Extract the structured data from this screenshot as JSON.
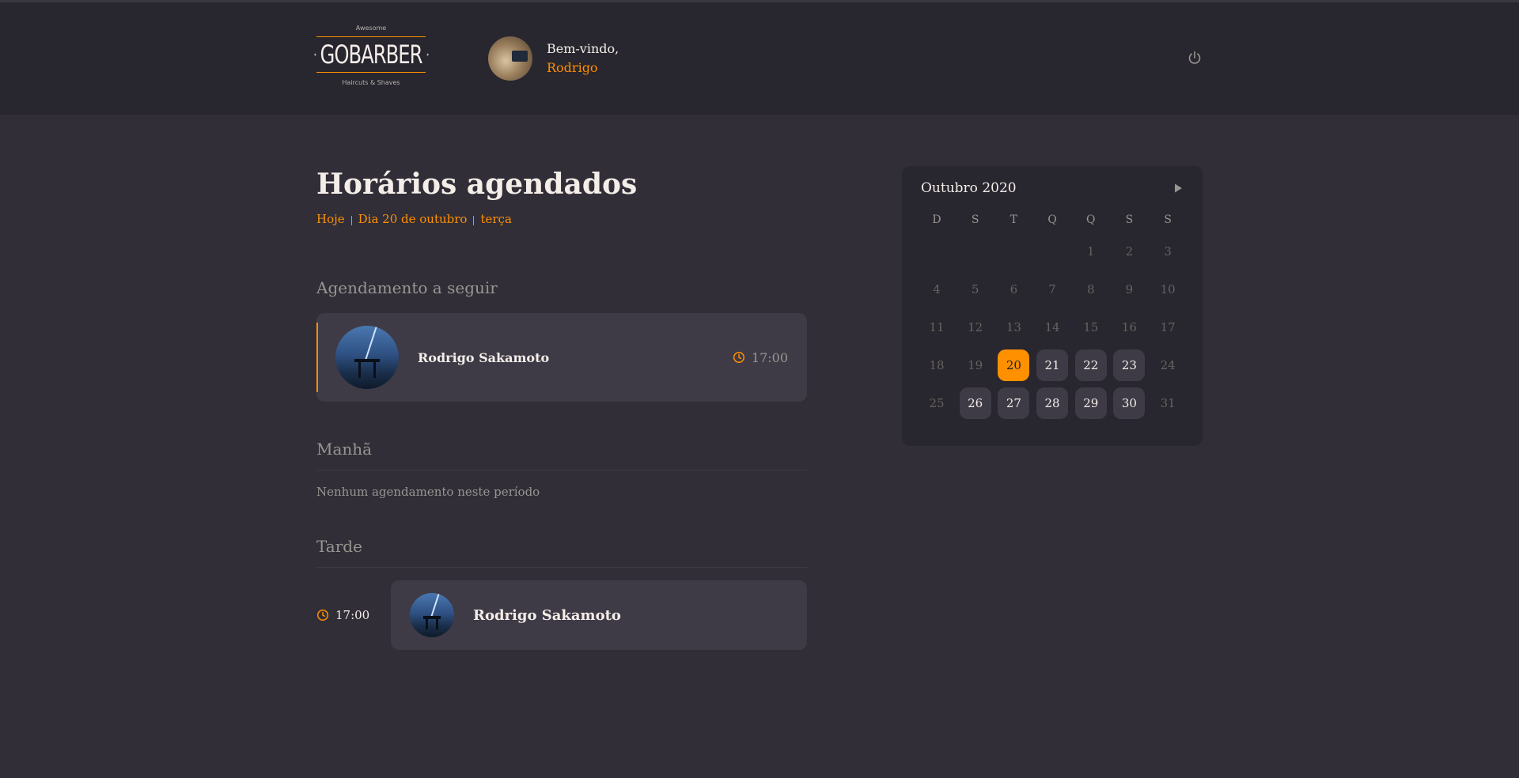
{
  "header": {
    "logo": {
      "top_text": "Awesome",
      "brand": "GOBARBER",
      "bottom_text": "Haircuts & Shaves"
    },
    "welcome_label": "Bem-vindo,",
    "user_name": "Rodrigo",
    "logout_icon": "power-icon"
  },
  "schedule": {
    "title": "Horários agendados",
    "date_parts": [
      "Hoje",
      "Dia 20 de outubro",
      "terça"
    ],
    "next": {
      "label": "Agendamento a seguir",
      "client_name": "Rodrigo Sakamoto",
      "time": "17:00"
    },
    "morning": {
      "label": "Manhã",
      "empty_text": "Nenhum agendamento neste período"
    },
    "afternoon": {
      "label": "Tarde",
      "appointments": [
        {
          "time": "17:00",
          "client_name": "Rodrigo Sakamoto"
        }
      ]
    }
  },
  "calendar": {
    "month_label": "Outubro 2020",
    "weekdays": [
      "D",
      "S",
      "T",
      "Q",
      "Q",
      "S",
      "S"
    ],
    "leading_blanks": 4,
    "days": [
      {
        "n": "1",
        "state": "disabled"
      },
      {
        "n": "2",
        "state": "disabled"
      },
      {
        "n": "3",
        "state": "disabled"
      },
      {
        "n": "4",
        "state": "disabled"
      },
      {
        "n": "5",
        "state": "disabled"
      },
      {
        "n": "6",
        "state": "disabled"
      },
      {
        "n": "7",
        "state": "disabled"
      },
      {
        "n": "8",
        "state": "disabled"
      },
      {
        "n": "9",
        "state": "disabled"
      },
      {
        "n": "10",
        "state": "disabled"
      },
      {
        "n": "11",
        "state": "disabled"
      },
      {
        "n": "12",
        "state": "disabled"
      },
      {
        "n": "13",
        "state": "disabled"
      },
      {
        "n": "14",
        "state": "disabled"
      },
      {
        "n": "15",
        "state": "disabled"
      },
      {
        "n": "16",
        "state": "disabled"
      },
      {
        "n": "17",
        "state": "disabled"
      },
      {
        "n": "18",
        "state": "disabled"
      },
      {
        "n": "19",
        "state": "disabled"
      },
      {
        "n": "20",
        "state": "selected"
      },
      {
        "n": "21",
        "state": "available"
      },
      {
        "n": "22",
        "state": "available"
      },
      {
        "n": "23",
        "state": "available"
      },
      {
        "n": "24",
        "state": "disabled"
      },
      {
        "n": "25",
        "state": "disabled"
      },
      {
        "n": "26",
        "state": "available"
      },
      {
        "n": "27",
        "state": "available"
      },
      {
        "n": "28",
        "state": "available"
      },
      {
        "n": "29",
        "state": "available"
      },
      {
        "n": "30",
        "state": "available"
      },
      {
        "n": "31",
        "state": "disabled"
      }
    ]
  },
  "colors": {
    "accent": "#ff9000",
    "background": "#312e38",
    "header_bg": "#28262e",
    "card_bg": "#3e3b47",
    "muted_text": "#999591",
    "disabled_text": "#666360",
    "text": "#f4ede8"
  }
}
